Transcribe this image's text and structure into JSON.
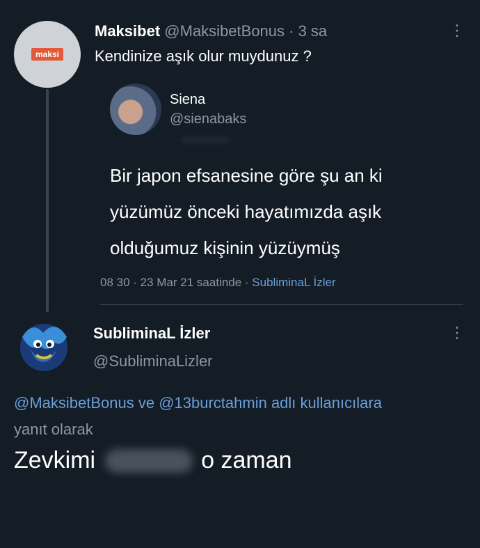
{
  "tweet": {
    "display_name": "Maksibet",
    "handle": "@MaksibetBonus",
    "time": " · 3 sa",
    "text": "Kendinize aşık olur muydunuz ?",
    "avatar_logo_text": "maksi",
    "quoted": {
      "display_name": "Siena",
      "handle": "@sienabaks",
      "text": "Bir japon efsanesine göre şu an ki yüzümüz önceki hayatımızda aşık olduğumuz kişinin yüzüymüş",
      "meta_time": "08 30 · 23 Mar 21 saatinde · ",
      "meta_source": "SubliminaL İzler"
    }
  },
  "reply": {
    "display_name": "SubliminaL İzler",
    "handle": "@SubliminaLizler",
    "reply_to": "@MaksibetBonus ve @13burctahmin adlı kullanıcılara",
    "reply_suffix": "yanıt olarak",
    "text_before": "Zevkimi",
    "text_after": "o zaman"
  },
  "icons": {
    "more": "more-vertical-icon"
  },
  "colors": {
    "background": "#141c26",
    "secondary_text": "#8b98a5",
    "link": "#6a9fd8"
  }
}
